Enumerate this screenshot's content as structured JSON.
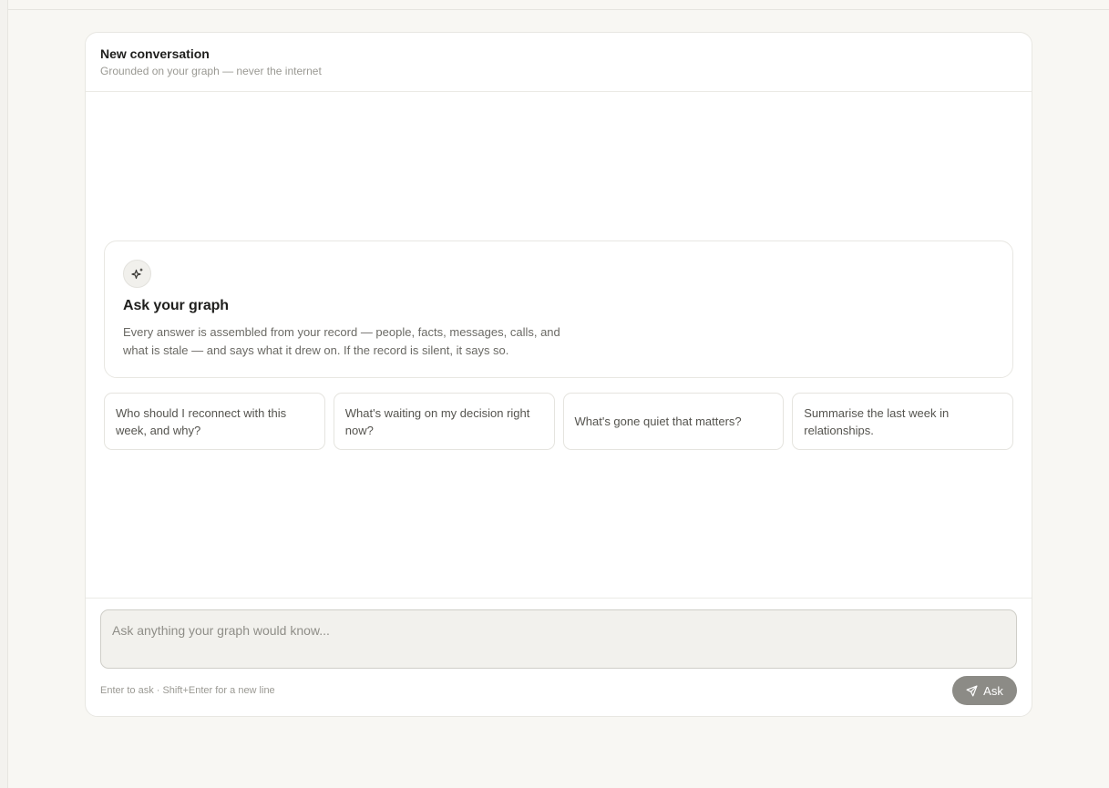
{
  "header": {
    "title": "New conversation",
    "subtitle": "Grounded on your graph — never the internet"
  },
  "intro": {
    "icon": "sparkle-icon",
    "title": "Ask your graph",
    "body": "Every answer is assembled from your record — people, facts, messages, calls, and what is stale — and says what it drew on. If the record is silent, it says so."
  },
  "suggestions": [
    "Who should I reconnect with this week, and why?",
    "What's waiting on my decision right now?",
    "What's gone quiet that matters?",
    "Summarise the last week in relationships."
  ],
  "composer": {
    "placeholder": "Ask anything your graph would know...",
    "hint": "Enter to ask · Shift+Enter for a new line",
    "ask_label": "Ask",
    "ask_icon": "send-icon"
  },
  "colors": {
    "background": "#f8f7f3",
    "panel": "#ffffff",
    "ask_button": "#8c8b86"
  }
}
